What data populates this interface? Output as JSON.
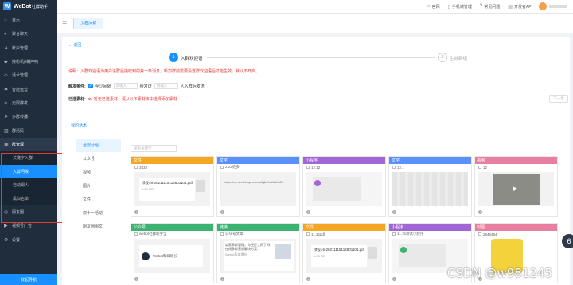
{
  "topbar": {
    "brand": "WeBot",
    "brand_sub": "社群助手",
    "links": [
      {
        "icon": "home-icon",
        "glyph": "⌂",
        "label": "官网"
      },
      {
        "icon": "phone-icon",
        "glyph": "▯",
        "label": "手机端管理"
      },
      {
        "icon": "question-icon",
        "glyph": "?",
        "label": "常见问题"
      },
      {
        "icon": "api-icon",
        "glyph": "▤",
        "label": "开发者API"
      }
    ]
  },
  "sidebar": {
    "items": [
      {
        "icon": "home-icon",
        "glyph": "⌂",
        "label": "首页"
      },
      {
        "icon": "chat-icon",
        "glyph": "◐",
        "label": "聚合聊天"
      },
      {
        "icon": "user-icon",
        "glyph": "♟",
        "label": "账户管理"
      },
      {
        "icon": "robot-icon",
        "glyph": "◆",
        "label": "接粉机(维护中)"
      },
      {
        "icon": "tag-icon",
        "glyph": "◇",
        "label": "话术管理"
      },
      {
        "icon": "setting-icon",
        "glyph": "✱",
        "label": "智能运营"
      },
      {
        "icon": "group-icon",
        "glyph": "◈",
        "label": "无限群发"
      },
      {
        "icon": "send-icon",
        "glyph": "➤",
        "label": "多群转播"
      },
      {
        "icon": "chart-icon",
        "glyph": "▥",
        "label": "群活码"
      },
      {
        "icon": "group-manage-icon",
        "glyph": "▣",
        "label": "群管理"
      }
    ],
    "sub_items": [
      {
        "label": "关键字入群"
      },
      {
        "label": "入群问候"
      },
      {
        "label": "自动踢人"
      },
      {
        "label": "黑白名单"
      }
    ],
    "more_items": [
      {
        "icon": "moments-icon",
        "glyph": "◎",
        "label": "朋友圈"
      },
      {
        "icon": "video-icon",
        "glyph": "▶",
        "label": "视频号广告"
      },
      {
        "icon": "settings-icon",
        "glyph": "⚙",
        "label": "设置"
      }
    ],
    "bottom_button": "收起导航"
  },
  "tabbar": {
    "hamburger": "☰",
    "active_tab": "入群问候"
  },
  "main": {
    "back_link": "← 返回",
    "steps": [
      {
        "num": "1",
        "label": "入群欢迎语"
      },
      {
        "num": "2",
        "label": "生效群组"
      }
    ],
    "description": "说明：入群欢迎语为用户进群后接收到的第一条消息，新加群前需要设置群欢迎语后才能生效，默认不开启。",
    "trigger": {
      "label": "触发条件:",
      "check_text": "至少间隔",
      "input1_placeholder": "请输入",
      "mid_text": "秒发送",
      "input2_placeholder": "请输入",
      "tail_text": "人入群后发送"
    },
    "selected": {
      "label": "已选素材:",
      "warning": "暂无已选素材，请从以下素材库中选择添加素材"
    },
    "next_button": "下一步",
    "library_tab": "我的话术",
    "search_placeholder": "搜索关键字",
    "categories": [
      "全部分组",
      "公众号",
      "视频",
      "图片",
      "文件",
      "双十一活动",
      "朋友圈图文"
    ]
  },
  "cards": [
    {
      "type": "文件",
      "color": "#f5a623",
      "meta": "3333",
      "kind": "file",
      "file_name": "绿投46-20211115114801101.pdf",
      "file_size": "1.03 MB",
      "foot": ""
    },
    {
      "type": "文字",
      "color": "#5b8ff9",
      "meta": "2.22更多",
      "kind": "text",
      "text": "https://mp.weixin.qq.com/s/bjkz9uWAVn3...",
      "foot": ""
    },
    {
      "type": "小程序",
      "color": "#a066d3",
      "meta": "12.12",
      "kind": "mini",
      "foot": ""
    },
    {
      "type": "文字",
      "color": "#5b8ff9",
      "meta": "12.1",
      "kind": "blurred",
      "foot": ""
    },
    {
      "type": "视频",
      "color": "#e87fa0",
      "meta": "12",
      "kind": "video",
      "foot": ""
    },
    {
      "type": "公众号",
      "color": "#3cb371",
      "meta": "webot社群助手全",
      "kind": "mp",
      "mp_name": "Webot私域增长",
      "foot": ""
    },
    {
      "type": "链接",
      "color": "#3cb371",
      "meta": "公众号文章",
      "kind": "link",
      "link_text": "商家多群管理，你还打工再了吗？在线多群营销解决方案...",
      "link_sub": "Webot私域增长",
      "foot": ""
    },
    {
      "type": "文件",
      "color": "#f5a623",
      "meta": "11.16pdf",
      "kind": "file",
      "file_name": "绿投46-20211115114801101.pdf",
      "file_size": "1.03 MB",
      "foot": ""
    },
    {
      "type": "小程序",
      "color": "#a066d3",
      "meta": "11.15测试小程序",
      "kind": "mini2",
      "foot": ""
    },
    {
      "type": "动图",
      "color": "#e87fa0",
      "meta": "2545484",
      "kind": "gif",
      "foot": ""
    }
  ],
  "watermark": "CSDN @w981245",
  "floater": "6"
}
